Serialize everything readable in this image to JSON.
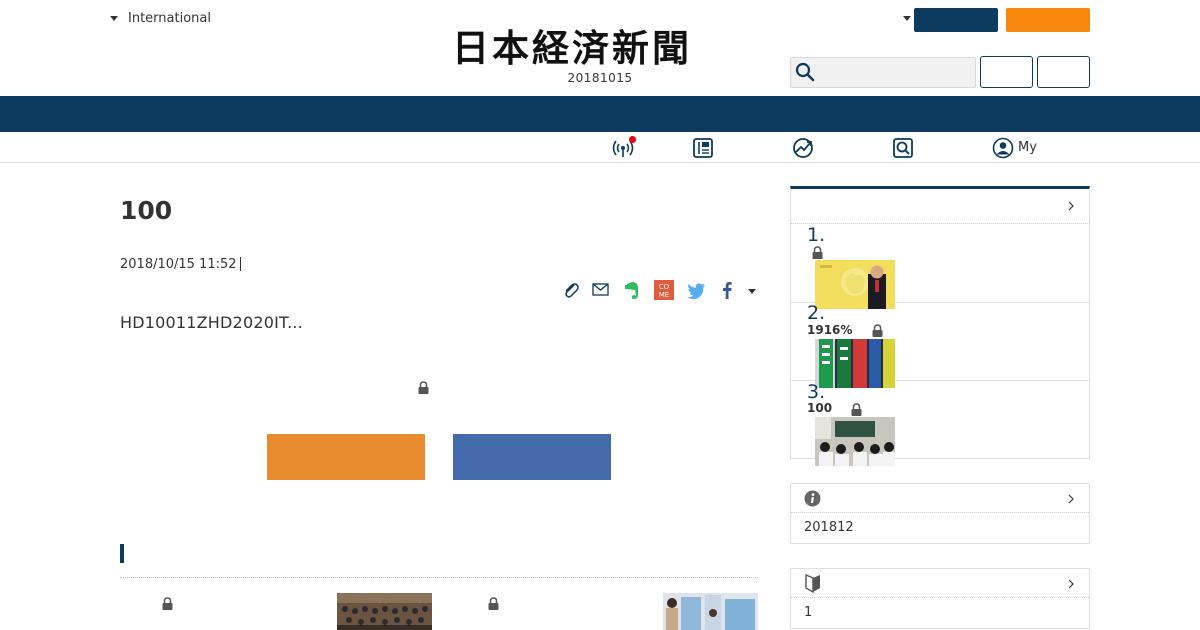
{
  "header": {
    "region_label": "International",
    "logo_text": "日本経済新聞",
    "date": "20181015"
  },
  "subnav": {
    "my_label": "My"
  },
  "article": {
    "title": "100",
    "timestamp": "2018/10/15 11:52",
    "lead": "HD10011ZHD2020IT..."
  },
  "ranking": {
    "items": [
      {
        "rank": "1.",
        "text": ""
      },
      {
        "rank": "2.",
        "text": "1916%"
      },
      {
        "rank": "3.",
        "text": "100"
      }
    ]
  },
  "info_panel": {
    "body": "201812"
  },
  "guide_panel": {
    "body": "1"
  },
  "colors": {
    "navy": "#0d3a5f",
    "orange": "#f7870f",
    "cta_orange": "#e98b2f",
    "cta_blue": "#436bac",
    "notification_red": "#e60012"
  }
}
